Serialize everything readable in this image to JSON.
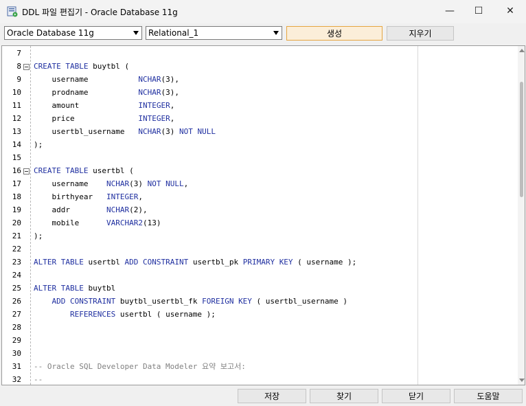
{
  "window": {
    "title": "DDL 파일 편집기 - Oracle Database 11g",
    "minimize_glyph": "—",
    "maximize_glyph": "☐",
    "close_glyph": "✕"
  },
  "toolbar": {
    "database_select": "Oracle Database 11g",
    "model_select": "Relational_1",
    "generate_label": "생성",
    "clear_label": "지우기"
  },
  "editor": {
    "lines": [
      {
        "n": "7",
        "fold": false,
        "html": ""
      },
      {
        "n": "8",
        "fold": true,
        "html": "<span class=\"k\">CREATE</span> <span class=\"k\">TABLE</span> buytbl ("
      },
      {
        "n": "9",
        "fold": false,
        "html": "    username           <span class=\"k\">NCHAR</span>(3),"
      },
      {
        "n": "10",
        "fold": false,
        "html": "    prodname           <span class=\"k\">NCHAR</span>(3),"
      },
      {
        "n": "11",
        "fold": false,
        "html": "    amount             <span class=\"k\">INTEGER</span>,"
      },
      {
        "n": "12",
        "fold": false,
        "html": "    price              <span class=\"k\">INTEGER</span>,"
      },
      {
        "n": "13",
        "fold": false,
        "html": "    usertbl_username   <span class=\"k\">NCHAR</span>(3) <span class=\"k\">NOT</span> <span class=\"k\">NULL</span>"
      },
      {
        "n": "14",
        "fold": false,
        "html": ");"
      },
      {
        "n": "15",
        "fold": false,
        "html": ""
      },
      {
        "n": "16",
        "fold": true,
        "html": "<span class=\"k\">CREATE</span> <span class=\"k\">TABLE</span> usertbl ("
      },
      {
        "n": "17",
        "fold": false,
        "html": "    username    <span class=\"k\">NCHAR</span>(3) <span class=\"k\">NOT</span> <span class=\"k\">NULL</span>,"
      },
      {
        "n": "18",
        "fold": false,
        "html": "    birthyear   <span class=\"k\">INTEGER</span>,"
      },
      {
        "n": "19",
        "fold": false,
        "html": "    addr        <span class=\"k\">NCHAR</span>(2),"
      },
      {
        "n": "20",
        "fold": false,
        "html": "    mobile      <span class=\"k\">VARCHAR2</span>(13)"
      },
      {
        "n": "21",
        "fold": false,
        "html": ");"
      },
      {
        "n": "22",
        "fold": false,
        "html": ""
      },
      {
        "n": "23",
        "fold": false,
        "html": "<span class=\"k\">ALTER</span> <span class=\"k\">TABLE</span> usertbl <span class=\"k\">ADD</span> <span class=\"k\">CONSTRAINT</span> usertbl_pk <span class=\"k\">PRIMARY</span> <span class=\"k\">KEY</span> ( username );"
      },
      {
        "n": "24",
        "fold": false,
        "html": ""
      },
      {
        "n": "25",
        "fold": false,
        "html": "<span class=\"k\">ALTER</span> <span class=\"k\">TABLE</span> buytbl"
      },
      {
        "n": "26",
        "fold": false,
        "html": "    <span class=\"k\">ADD</span> <span class=\"k\">CONSTRAINT</span> buytbl_usertbl_fk <span class=\"k\">FOREIGN</span> <span class=\"k\">KEY</span> ( usertbl_username )"
      },
      {
        "n": "27",
        "fold": false,
        "html": "        <span class=\"k\">REFERENCES</span> usertbl ( username );"
      },
      {
        "n": "28",
        "fold": false,
        "html": ""
      },
      {
        "n": "29",
        "fold": false,
        "html": ""
      },
      {
        "n": "30",
        "fold": false,
        "html": ""
      },
      {
        "n": "31",
        "fold": false,
        "html": "<span class=\"c\">-- Oracle SQL Developer Data Modeler 요약 보고서:</span>"
      },
      {
        "n": "32",
        "fold": false,
        "html": "<span class=\"c\">--</span>"
      }
    ]
  },
  "footer": {
    "save_label": "저장",
    "find_label": "찾기",
    "close_label": "닫기",
    "help_label": "도움말"
  }
}
